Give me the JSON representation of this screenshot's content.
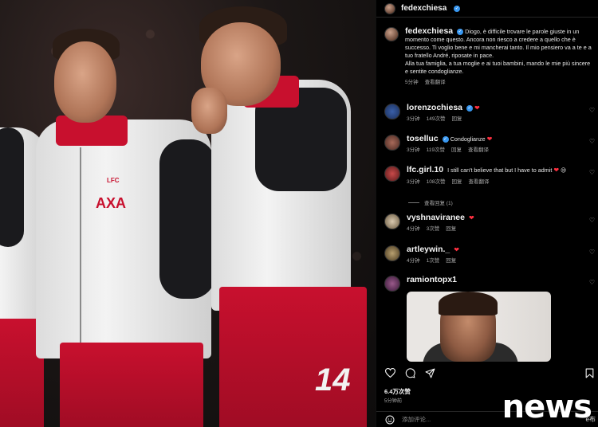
{
  "photo": {
    "left_player_badge": "LFC",
    "left_player_sponsor": "AXA",
    "right_player_number": "14"
  },
  "post": {
    "username": "fedexchiesa",
    "caption_user": "fedexchiesa",
    "caption_text": "Diogo, è difficile trovare le parole giuste in un momento come questo. Ancora non riesco a credere a quello che è successo. Ti voglio bene e mi mancherai tanto. Il mio pensiero va a te e a tuo fratello André, riposate in pace.",
    "caption_text_2": "Alla tua famiglia, a tua moglie e ai tuoi bambini, mando le mie più sincere e sentite condoglianze.",
    "caption_time": "5分钟",
    "caption_translate": "查看翻译",
    "likes": "6.4万次赞",
    "time_ago": "5分钟前",
    "add_comment_placeholder": "添加评论..."
  },
  "comments": [
    {
      "user": "lorenzochiesa",
      "verified": true,
      "text": "",
      "heart": "❤",
      "time": "3分钟",
      "likes": "149次赞",
      "reply": "回复",
      "translate": ""
    },
    {
      "user": "toselluc",
      "verified": true,
      "text": "Condoglianze",
      "heart": "❤",
      "time": "3分钟",
      "likes": "119次赞",
      "reply": "回复",
      "translate": "查看翻译"
    },
    {
      "user": "lfc.girl.10",
      "verified": false,
      "text": "I still can't believe that but I have to admit",
      "heart": "❤",
      "emoji": "😢",
      "time": "3分钟",
      "likes": "108次赞",
      "reply": "回复",
      "translate": "查看翻译"
    },
    {
      "user": "vyshnaviranee",
      "verified": false,
      "text": "",
      "heart": "❤",
      "time": "4分钟",
      "likes": "3次赞",
      "reply": "回复",
      "translate": ""
    },
    {
      "user": "artleywin._",
      "verified": false,
      "text": "",
      "heart": "❤",
      "time": "4分钟",
      "likes": "1次赞",
      "reply": "回复",
      "translate": ""
    },
    {
      "user": "ramiontopx1",
      "verified": false,
      "text": "",
      "heart": "",
      "time": "",
      "likes": "",
      "reply": "",
      "translate": ""
    }
  ],
  "replies_toggle": "查看回复 (1)",
  "watermark": {
    "text": "news",
    "sub": "e布"
  },
  "icons": {
    "heart": "heart-icon",
    "comment": "comment-icon",
    "share": "share-icon",
    "save": "bookmark-icon"
  }
}
